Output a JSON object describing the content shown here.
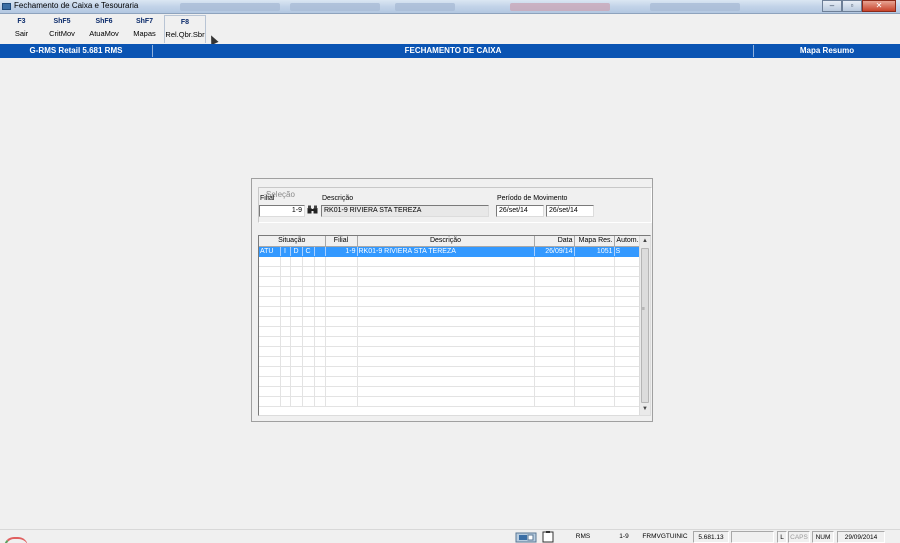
{
  "window": {
    "title": "Fechamento de Caixa e Tesouraria",
    "buttons": [
      "–",
      "▫",
      "✕"
    ]
  },
  "toolbar": {
    "items": [
      {
        "key": "F3",
        "label": "Sair"
      },
      {
        "key": "ShF5",
        "label": "CritMov"
      },
      {
        "key": "ShF6",
        "label": "AtuaMov"
      },
      {
        "key": "ShF7",
        "label": "Mapas"
      },
      {
        "key": "F8",
        "label": "Rel.Qbr.Sbr"
      }
    ]
  },
  "header": {
    "left": "G-RMS Retail 5.681 RMS",
    "center": "FECHAMENTO DE CAIXA",
    "right": "Mapa Resumo"
  },
  "selecao": {
    "group_title": "Seleção",
    "filial_label": "Filial",
    "filial_value": "1-9",
    "descricao_label": "Descrição",
    "descricao_value": "RK01-9 RIVIERA STA TEREZA",
    "periodo_label": "Período de Movimento",
    "periodo_de": "26/set/14",
    "periodo_ate": "26/set/14"
  },
  "grid": {
    "headers": {
      "situacao": "Situação",
      "filial": "Filial",
      "descricao": "Descrição",
      "data": "Data",
      "mapa": "Mapa Res.",
      "autom": "Autom."
    },
    "rows": [
      {
        "s1": "ATU",
        "s2": "I",
        "s3": "D",
        "s4": "C",
        "filial": "1-9",
        "descricao": "RK01-9 RIVIERA STA TEREZA",
        "data": "26/09/14",
        "mapa": "1051",
        "autom": "S"
      }
    ],
    "scroll_up": "▲",
    "scroll_down": "▼"
  },
  "status": {
    "rms": "RMS",
    "filial": "1-9",
    "program": "FRMVGTUINIC",
    "version": "5.681.13",
    "l": "L",
    "caps": "CAPS",
    "num": "NUM",
    "date": "29/09/2014"
  }
}
